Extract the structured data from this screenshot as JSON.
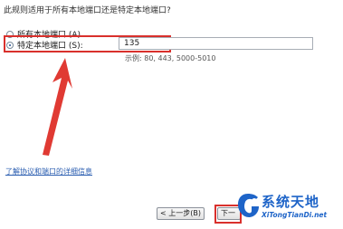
{
  "dialog": {
    "question": "此规则适用于所有本地端口还是特定本地端口?",
    "all_ports_label": "所有本地端口 (A)",
    "specific_ports_label": "特定本地端口 (S):",
    "port_value": "135",
    "example_text": "示例: 80, 443, 5000-5010",
    "help_link": "了解协议和端口的详细信息",
    "back_button": "< 上一步(B)",
    "next_button": "下一步"
  },
  "selected_option": "specific_ports",
  "colors": {
    "highlight_red": "#d9302c",
    "link_blue": "#2a5db0",
    "watermark_blue": "#1e64c8"
  },
  "watermark": {
    "title": "系统天地",
    "url": "XiTongTianDi.net"
  }
}
